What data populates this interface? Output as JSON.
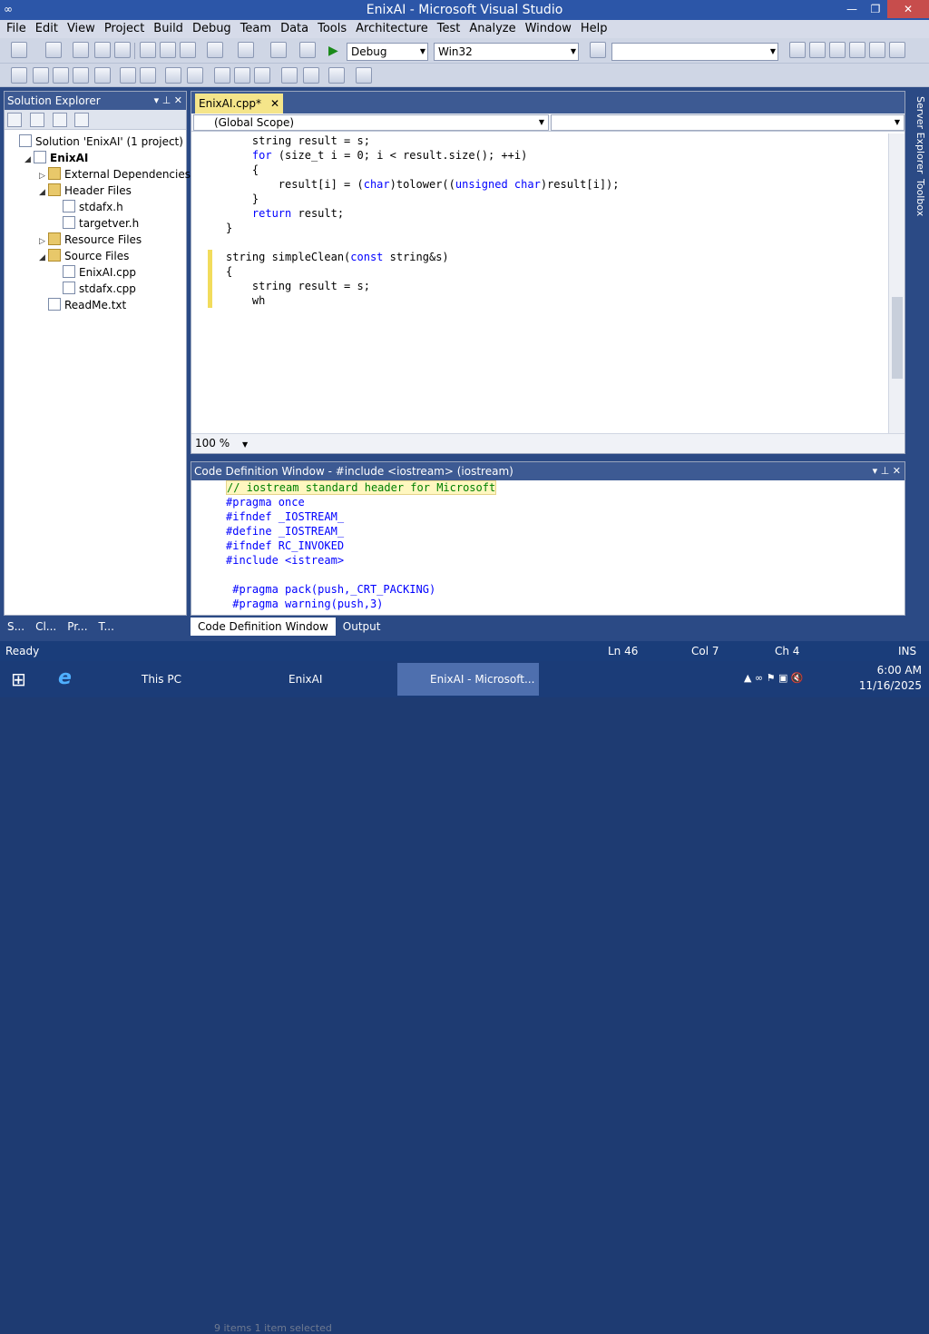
{
  "window": {
    "title": "EnixAI - Microsoft Visual Studio"
  },
  "menu": [
    "File",
    "Edit",
    "View",
    "Project",
    "Build",
    "Debug",
    "Team",
    "Data",
    "Tools",
    "Architecture",
    "Test",
    "Analyze",
    "Window",
    "Help"
  ],
  "toolbar": {
    "config": "Debug",
    "platform": "Win32",
    "search_value": ""
  },
  "solution_explorer": {
    "title": "Solution Explorer",
    "items": [
      {
        "label": "Solution 'EnixAI' (1 project)",
        "indent": 0,
        "icon": "solution-icon"
      },
      {
        "label": "EnixAI",
        "indent": 1,
        "icon": "project-icon"
      },
      {
        "label": "External Dependencies",
        "indent": 2,
        "icon": "folder-icon"
      },
      {
        "label": "Header Files",
        "indent": 2,
        "icon": "folder-icon"
      },
      {
        "label": "stdafx.h",
        "indent": 3,
        "icon": "header-file-icon"
      },
      {
        "label": "targetver.h",
        "indent": 3,
        "icon": "header-file-icon"
      },
      {
        "label": "Resource Files",
        "indent": 2,
        "icon": "folder-icon"
      },
      {
        "label": "Source Files",
        "indent": 2,
        "icon": "folder-icon"
      },
      {
        "label": "EnixAI.cpp",
        "indent": 3,
        "icon": "cpp-file-icon"
      },
      {
        "label": "stdafx.cpp",
        "indent": 3,
        "icon": "cpp-file-icon"
      },
      {
        "label": "ReadMe.txt",
        "indent": 2,
        "icon": "text-file-icon"
      }
    ]
  },
  "editor": {
    "tab": "EnixAI.cpp*",
    "scope": "(Global Scope)",
    "zoom": "100 %",
    "code": [
      "    string result = s;",
      "    for (size_t i = 0; i < result.size(); ++i)",
      "    {",
      "        result[i] = (char)tolower((unsigned char)result[i]);",
      "    }",
      "    return result;",
      "}",
      "",
      "string simpleClean(const string&s)",
      "{",
      "    string result = s;",
      "    wh"
    ]
  },
  "code_definition": {
    "title": "Code Definition Window - #include <iostream> (iostream)",
    "lines": [
      "// iostream standard header for Microsoft",
      "#pragma once",
      "#ifndef _IOSTREAM_",
      "#define _IOSTREAM_",
      "#ifndef RC_INVOKED",
      "#include <istream>",
      "",
      " #pragma pack(push,_CRT_PACKING)",
      " #pragma warning(push,3)"
    ]
  },
  "bottom_tabs_left": [
    "S...",
    "Cl...",
    "Pr...",
    "T..."
  ],
  "bottom_tabs": [
    "Code Definition Window",
    "Output"
  ],
  "status": {
    "text": "Ready",
    "ln": "Ln 46",
    "col": "Col 7",
    "ch": "Ch 4",
    "mode": "INS"
  },
  "right_sidebar": [
    "Server Explorer",
    "Toolbox"
  ],
  "taskbar": {
    "items": [
      "This PC",
      "EnixAI",
      "EnixAI - Microsoft..."
    ],
    "time": "6:00 AM",
    "date": "11/16/2025",
    "ghost_text": "9 items    1 item selected"
  }
}
